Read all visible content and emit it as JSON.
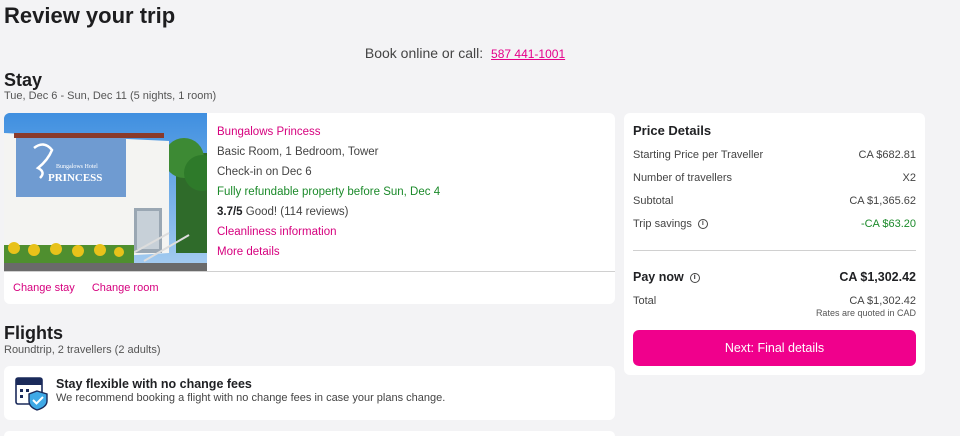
{
  "page": {
    "title": "Review your trip",
    "book_prefix": "Book online or call:",
    "phone": "587 441-1001"
  },
  "stay": {
    "title": "Stay",
    "dates": "Tue, Dec 6 - Sun, Dec 11 (5 nights, 1 room)",
    "hotel": {
      "name": "Bungalows Princess",
      "room": "Basic Room, 1 Bedroom, Tower",
      "checkin": "Check-in on Dec 6",
      "refund": "Fully refundable property before Sun, Dec 4",
      "rating": "3.7/5",
      "rating_text": "Good! (114 reviews)",
      "cleanliness": "Cleanliness information",
      "more": "More details",
      "sign_line1": "Bungalows Hotel",
      "sign_line2": "PRINCESS"
    },
    "actions": {
      "change_stay": "Change stay",
      "change_room": "Change room"
    }
  },
  "flights": {
    "title": "Flights",
    "subtitle": "Roundtrip, 2 travellers (2 adults)",
    "flex_title": "Stay flexible with no change fees",
    "flex_desc": "We recommend booking a flight with no change fees in case your plans change."
  },
  "price": {
    "title": "Price Details",
    "rows": [
      {
        "label": "Starting Price per Traveller",
        "value": "CA $682.81"
      },
      {
        "label": "Number of travellers",
        "value": "X2"
      },
      {
        "label": "Subtotal",
        "value": "CA $1,365.62"
      },
      {
        "label": "Trip savings",
        "value": "-CA $63.20"
      }
    ],
    "pay_now_label": "Pay now",
    "pay_now_value": "CA $1,302.42",
    "total_label": "Total",
    "total_value": "CA $1,302.42",
    "rates_note": "Rates are quoted in CAD",
    "next_button": "Next: Final details"
  },
  "colors": {
    "brand": "#f0008c",
    "link": "#d6007e",
    "success": "#1b8a2a"
  }
}
